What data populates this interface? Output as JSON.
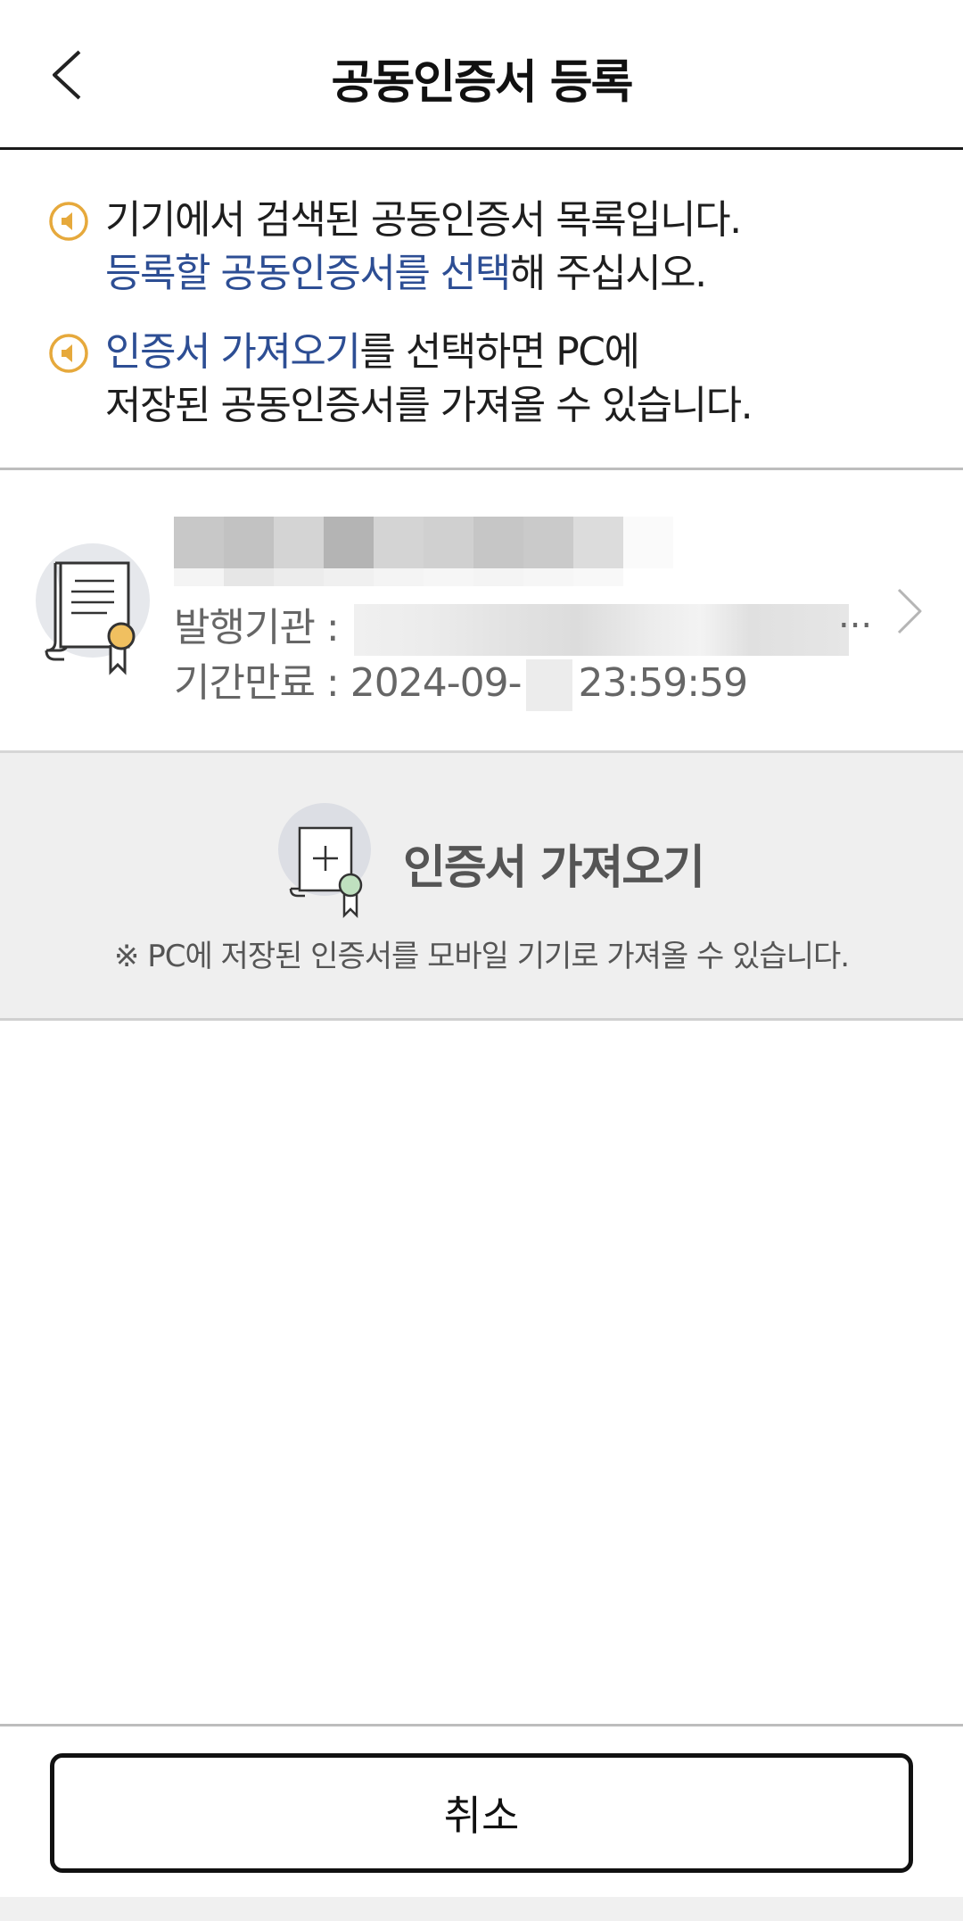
{
  "header": {
    "title": "공동인증서 등록",
    "back_icon": "chevron-left-icon"
  },
  "notices": [
    {
      "icon": "speaker-icon",
      "line1": "기기에서 검색된 공동인증서 목록입니다.",
      "line2_highlight": "등록할 공동인증서를 선택",
      "line2_rest": "해 주십시오."
    },
    {
      "icon": "speaker-icon",
      "line1_highlight": "인증서 가져오기",
      "line1_rest": "를 선택하면 PC에",
      "line2": "저장된 공동인증서를 가져올 수 있습니다."
    }
  ],
  "certificate": {
    "icon": "certificate-icon",
    "issuer_label": "발행기관 :",
    "issuer_ellipsis": "...",
    "expiry_label": "기간만료 :",
    "expiry_date_prefix": "2024-09-",
    "expiry_time": "23:59:59",
    "arrow_icon": "chevron-right-icon"
  },
  "import": {
    "icon": "certificate-add-icon",
    "title": "인증서 가져오기",
    "note": "※ PC에 저장된 인증서를 모바일 기기로 가져올 수 있습니다."
  },
  "footer": {
    "cancel_label": "취소"
  },
  "colors": {
    "highlight": "#2d4e94",
    "notice_icon": "#e6a93c",
    "seal_gold": "#f0c060",
    "seal_green": "#bfe0bf"
  }
}
